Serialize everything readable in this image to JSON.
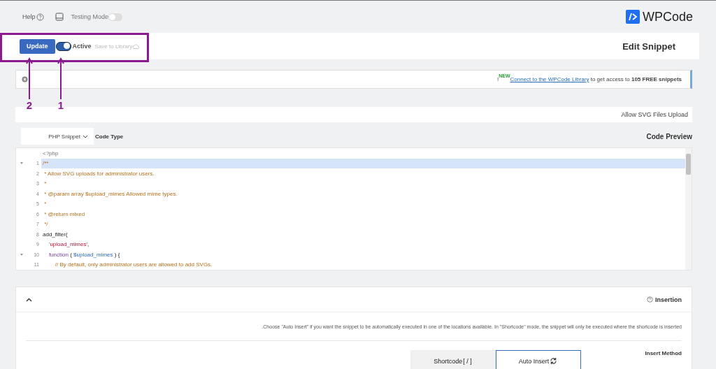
{
  "topbar": {
    "help": "Help",
    "testing_mode": {
      "label": "Testing Mode",
      "on": false
    },
    "logo": "WPCode"
  },
  "header": {
    "update": "Update",
    "active": {
      "label": "Active",
      "on": true
    },
    "save_to_library": "Save to Library",
    "title": "Edit Snippet"
  },
  "notice": {
    "prefix": "!",
    "badge": "NEW",
    "link": "Connect to the WPCode Library",
    "text": " to get access to **105 FREE snippets**"
  },
  "snippet_title": "Allow SVG Files Upload",
  "code_type": {
    "value": "PHP Snippet",
    "label": "Code Type"
  },
  "code_preview": {
    "label": "Code Preview",
    "lines": [
      {
        "active": false,
        "tokens": [
          {
            "kind": "plain",
            "text": "<?php"
          }
        ]
      },
      {
        "number": "1",
        "foldable": true,
        "active": true,
        "tokens": [
          {
            "kind": "comment",
            "text": "/**"
          }
        ]
      },
      {
        "number": "2",
        "active": false,
        "tokens": [
          {
            "kind": "comment",
            "text": " * Allow SVG uploads for administrator users."
          }
        ]
      },
      {
        "number": "3",
        "active": false,
        "tokens": [
          {
            "kind": "comment",
            "text": " *"
          }
        ]
      },
      {
        "number": "4",
        "active": false,
        "tokens": [
          {
            "kind": "comment",
            "text": " * @param array $upload_mimes Allowed mime types."
          }
        ]
      },
      {
        "number": "5",
        "active": false,
        "tokens": [
          {
            "kind": "comment",
            "text": " *"
          }
        ]
      },
      {
        "number": "6",
        "active": false,
        "tokens": [
          {
            "kind": "comment",
            "text": " * @return mixed"
          }
        ]
      },
      {
        "number": "7",
        "active": false,
        "tokens": [
          {
            "kind": "comment",
            "text": " */"
          }
        ]
      },
      {
        "number": "8",
        "active": false,
        "tokens": [
          {
            "kind": "call",
            "text": "add_filter("
          }
        ]
      },
      {
        "number": "9",
        "active": false,
        "tokens": [
          {
            "kind": "string",
            "text": "    'upload_mimes'"
          },
          {
            "kind": "call",
            "text": ","
          }
        ]
      },
      {
        "number": "10",
        "foldable": true,
        "active": false,
        "tokens": [
          {
            "kind": "keyword",
            "text": "    function"
          },
          {
            "kind": "call",
            "text": " ( "
          },
          {
            "kind": "variable",
            "text": "$upload_mimes"
          },
          {
            "kind": "call",
            "text": " ) {"
          }
        ]
      },
      {
        "number": "11",
        "active": false,
        "tokens": [
          {
            "kind": "comment",
            "text": "        // By default, only administrator users are allowed to add SVGs."
          }
        ]
      }
    ]
  },
  "insertion": {
    "title": "Insertion",
    "expanded": true,
    "description": ".Choose \"Auto Insert\" if you want the snippet to be automatically executed in one of the locations available. In \"Shortcode\" mode, the snippet will only be executed where the shortcode is inserted",
    "method_label": "Insert Method",
    "methods": [
      {
        "label": "Shortcode",
        "kind": "shortcode",
        "icon_text": "[ / ]",
        "selected": false
      },
      {
        "label": "Auto Insert",
        "kind": "auto",
        "selected": true
      }
    ]
  },
  "annotations": [
    {
      "number": "2"
    },
    {
      "number": "1"
    }
  ]
}
